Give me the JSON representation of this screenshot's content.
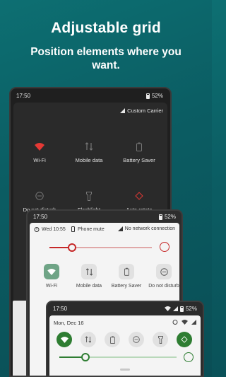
{
  "header": {
    "title": "Adjustable grid",
    "subtitle": "Position elements where you want."
  },
  "phone_dark": {
    "time": "17:50",
    "battery": "52%",
    "carrier": "Custom Carrier",
    "tiles": [
      {
        "label": "Wi-Fi",
        "icon": "wifi-icon",
        "color": "#e53935"
      },
      {
        "label": "Mobile data",
        "icon": "mobile-data-icon",
        "color": "#777777"
      },
      {
        "label": "Battery Saver",
        "icon": "battery-saver-icon",
        "color": "#777777"
      },
      {
        "label": "Do not disturb",
        "icon": "dnd-icon",
        "color": "#777777"
      },
      {
        "label": "Flashlight",
        "icon": "flashlight-icon",
        "color": "#777777"
      },
      {
        "label": "Auto-rotate",
        "icon": "auto-rotate-icon",
        "color": "#e53935"
      }
    ]
  },
  "phone_light": {
    "time": "17:50",
    "battery": "52%",
    "date": "Wed 10:55",
    "phone_mode": "Phone mute",
    "network": "No network connection",
    "brightness": 0.22,
    "tiles": [
      {
        "label": "Wi-Fi",
        "icon": "wifi-icon",
        "active": true
      },
      {
        "label": "Mobile data",
        "icon": "mobile-data-icon",
        "active": false
      },
      {
        "label": "Battery Saver",
        "icon": "battery-saver-icon",
        "active": false
      },
      {
        "label": "Do not disturb",
        "icon": "dnd-icon",
        "active": false
      }
    ]
  },
  "phone_front": {
    "time": "17:50",
    "battery": "52%",
    "date": "Mon, Dec 16",
    "brightness": 0.22
  },
  "colors": {
    "accent_red": "#c62828",
    "accent_green": "#2e7d32",
    "background_teal": "#0b5d63"
  }
}
